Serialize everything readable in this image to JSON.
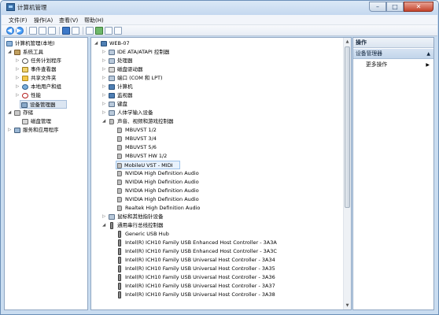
{
  "window": {
    "title": "计算机管理"
  },
  "caption": {
    "minimize": "–",
    "maximize": "□",
    "close": "✕"
  },
  "menu": [
    "文件(F)",
    "操作(A)",
    "查看(V)",
    "帮助(H)"
  ],
  "left_tree": {
    "root": "计算机管理(本地)",
    "system_tools": "系统工具",
    "task_scheduler": "任务计划程序",
    "event_viewer": "事件查看器",
    "shared_folders": "共享文件夹",
    "local_users": "本地用户和组",
    "performance": "性能",
    "device_manager": "设备管理器",
    "storage": "存储",
    "disk_management": "磁盘管理",
    "services": "服务和应用程序"
  },
  "device_tree": {
    "root": "WEB-07",
    "categories": {
      "ide": "IDE ATA/ATAPI 控制器",
      "cpu": "处理器",
      "disk": "磁盘驱动器",
      "ports": "端口 (COM 和 LPT)",
      "computer": "计算机",
      "monitor": "监视器",
      "keyboard": "键盘",
      "hid": "人体学输入设备",
      "sound": "声音、视频和游戏控制器",
      "mouse": "鼠标和其他指针设备",
      "usb": "通用串行总线控制器"
    },
    "sound_devices": [
      "MBUVST 1/2",
      "MBUVST 3/4",
      "MBUVST 5/6",
      "MBUVST HW 1/2",
      "MobileU VST - MIDI",
      "NVIDIA High Definition Audio",
      "NVIDIA High Definition Audio",
      "NVIDIA High Definition Audio",
      "NVIDIA High Definition Audio",
      "Realtek High Definition Audio"
    ],
    "usb_devices": [
      "Generic USB Hub",
      "Intel(R) ICH10 Family USB Enhanced Host Controller - 3A3A",
      "Intel(R) ICH10 Family USB Enhanced Host Controller - 3A3C",
      "Intel(R) ICH10 Family USB Universal Host Controller - 3A34",
      "Intel(R) ICH10 Family USB Universal Host Controller - 3A35",
      "Intel(R) ICH10 Family USB Universal Host Controller - 3A36",
      "Intel(R) ICH10 Family USB Universal Host Controller - 3A37",
      "Intel(R) ICH10 Family USB Universal Host Controller - 3A38"
    ]
  },
  "actions": {
    "header": "操作",
    "section": "设备管理器",
    "more": "更多操作"
  }
}
